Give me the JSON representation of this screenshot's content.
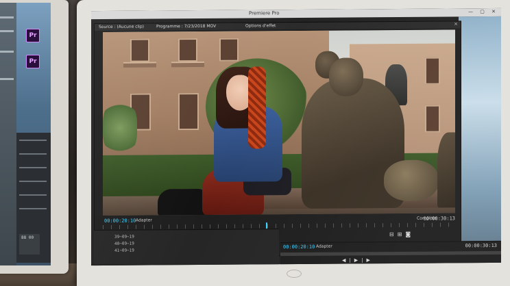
{
  "left_monitor": {
    "app_icons": [
      {
        "icon": "premiere-pro-icon",
        "label": "Pr"
      },
      {
        "icon": "premiere-pro-icon",
        "label": "Pr"
      }
    ],
    "tool_readout": "88 00"
  },
  "premiere": {
    "titlebar": "Premiere Pro",
    "tabs": [
      "Source : (Aucune clip)",
      "Programme : 7/23/2018 MOV",
      "Options d'effet"
    ],
    "program": {
      "current_timecode": "00:00:20:10",
      "fit_label": "Adapter",
      "quality_label": "Complète",
      "duration_timecode": "00:00:30:13"
    },
    "project_bins": [
      "39~09~19",
      "40~09~19",
      "41~09~19"
    ],
    "timeline": {
      "current_timecode": "00:00:20:10",
      "fit_label": "Adapter",
      "duration_timecode": "00:00:30:13"
    }
  },
  "colors": {
    "accent": "#3ad1ff",
    "premiere_purple": "#2a0f3d",
    "panel_bg": "#1f1f1f"
  }
}
